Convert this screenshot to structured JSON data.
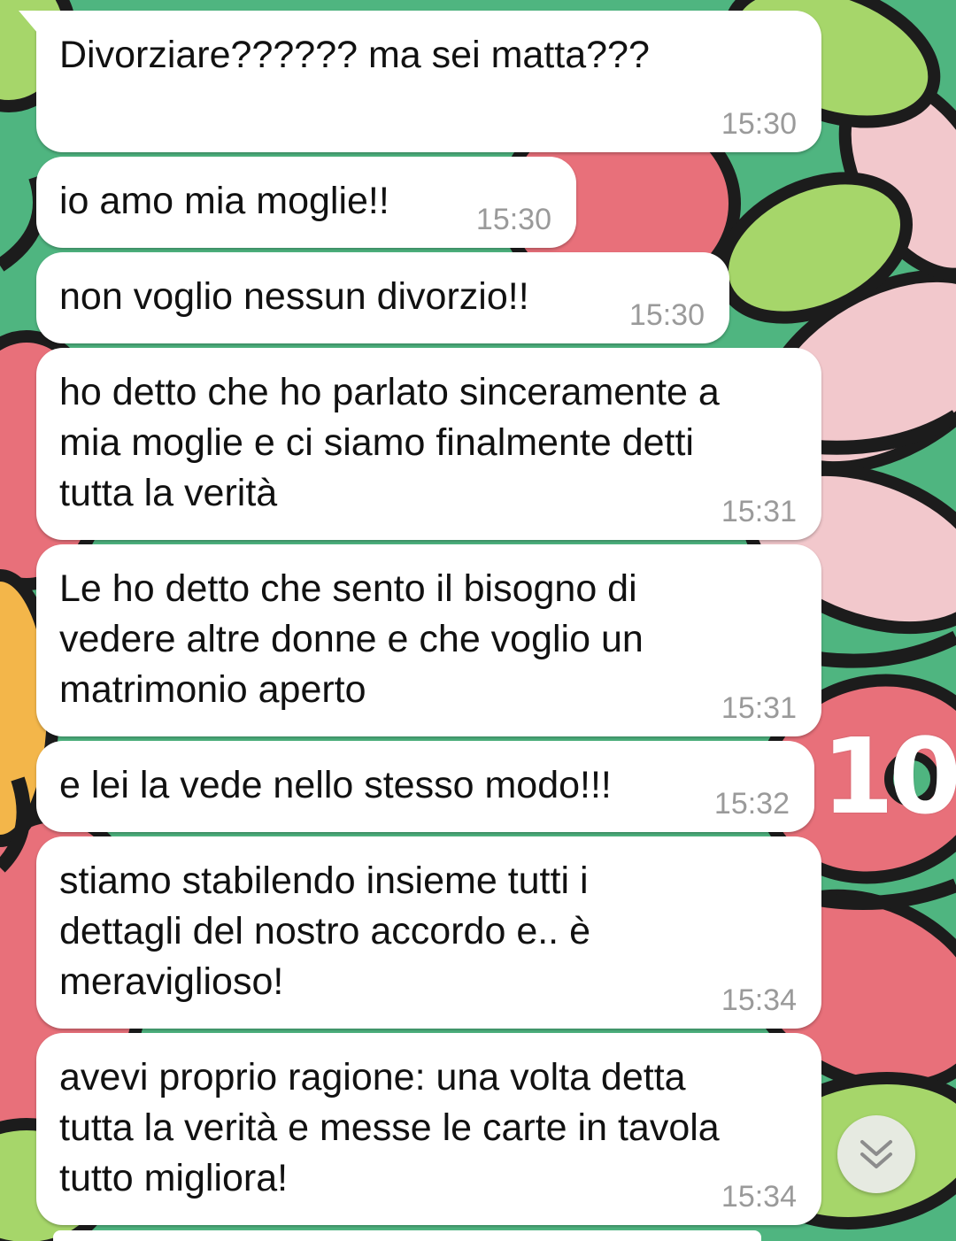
{
  "theme": {
    "bubble_color": "#ffffff",
    "text_color": "#111111",
    "time_color": "#9a9a9a",
    "wallpaper_colors": [
      "#4fb580",
      "#e8707a",
      "#f2c8cc",
      "#a6d66a",
      "#f3b64a",
      "#1c1c1c"
    ]
  },
  "messages": [
    {
      "text": "Divorziare?????? ma sei matta???",
      "time": "15:30"
    },
    {
      "text": "io amo mia moglie!!",
      "time": "15:30"
    },
    {
      "text": "non voglio nessun divorzio!!",
      "time": "15:30"
    },
    {
      "text": "ho detto che ho parlato sinceramente a\nmia moglie e ci siamo finalmente detti\ntutta la verità",
      "time": "15:31"
    },
    {
      "text": "Le ho detto che sento il bisogno di\nvedere altre donne e che voglio un\nmatrimonio aperto",
      "time": "15:31"
    },
    {
      "text": "e lei la vede nello stesso modo!!!",
      "time": "15:32"
    },
    {
      "text": "stiamo stabilendo insieme tutti i\ndettagli del nostro accordo e.. è\nmeraviglioso!",
      "time": "15:34"
    },
    {
      "text": "avevi proprio ragione: una volta detta\ntutta la verità e messe le carte in tavola\ntutto migliora!",
      "time": "15:34"
    }
  ],
  "overlay": {
    "counter": "10"
  },
  "scroll_button": {
    "icon": "double-chevron-down-icon"
  }
}
